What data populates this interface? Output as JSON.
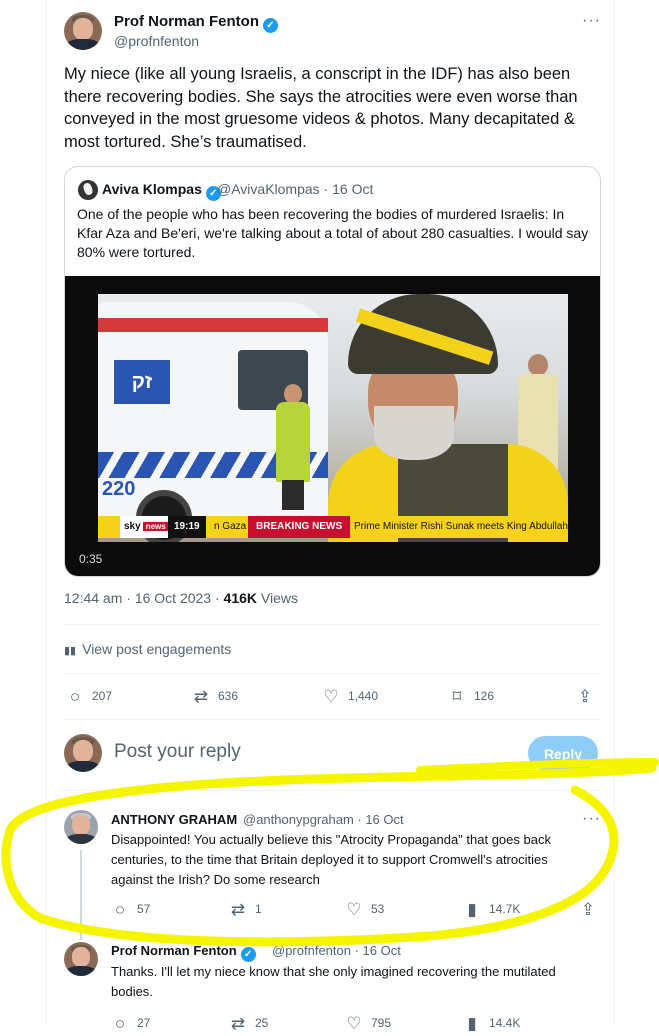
{
  "main_tweet": {
    "author_name": "Prof Norman Fenton",
    "author_handle": "@profnfenton",
    "text": "My niece (like all young Israelis, a conscript in the IDF) has also been there recovering bodies. She says the atrocities were even worse than conveyed in the most gruesome videos & photos. Many decapitated & most tortured. She’s traumatised.",
    "more": "···",
    "timestamp": "12:44 am · 16 Oct 2023 · ",
    "views_count": "416K",
    "views_label": " Views",
    "engagements_label": "View post engagements",
    "actions": {
      "replies": "207",
      "reposts": "636",
      "likes": "1,440",
      "bookmarks": "126"
    }
  },
  "quoted_tweet": {
    "author_name": "Aviva Klompas",
    "author_handle": "@AvivaKlompas · 16 Oct",
    "text": "One of the people who has been recovering the bodies of murdered Israelis: In Kfar Aza and Be'eri, we're talking about a total of about 280 casualties. I would say 80% were tortured.",
    "video": {
      "ambulance_number": "220",
      "ambulance_logo": "זק",
      "ticker_channel": "sky",
      "ticker_news": "news",
      "ticker_time": "19:19",
      "ticker_gaza": "n Gaza",
      "ticker_breaking": "BREAKING NEWS",
      "ticker_headline": "Prime Minister Rishi Sunak meets King Abdullah of Jorda",
      "elapsed": "0:35"
    }
  },
  "reply_box": {
    "placeholder": "Post your reply",
    "button": "Reply"
  },
  "replies": [
    {
      "author_name": "ANTHONY GRAHAM",
      "author_handle": "@anthonypgraham · 16 Oct",
      "text": "Disappointed! You actually believe this \"Atrocity Propaganda\" that goes back centuries, to the time that Britain deployed it to support Cromwell's atrocities against the Irish?  Do some research",
      "more": "···",
      "actions": {
        "replies": "57",
        "reposts": "1",
        "likes": "53",
        "views": "14.7K"
      }
    },
    {
      "author_name": "Prof Norman Fenton",
      "author_handle": "@profnfenton · 16 Oct",
      "text": "Thanks. I'll let my niece know that she only imagined recovering the mutilated bodies.",
      "actions": {
        "replies": "27",
        "reposts": "25",
        "likes": "795",
        "views": "14.4K"
      }
    }
  ],
  "colors": {
    "accent": "#1d9bf0",
    "highlight": "#f5f500",
    "reply_button": "#8ecdf8"
  }
}
